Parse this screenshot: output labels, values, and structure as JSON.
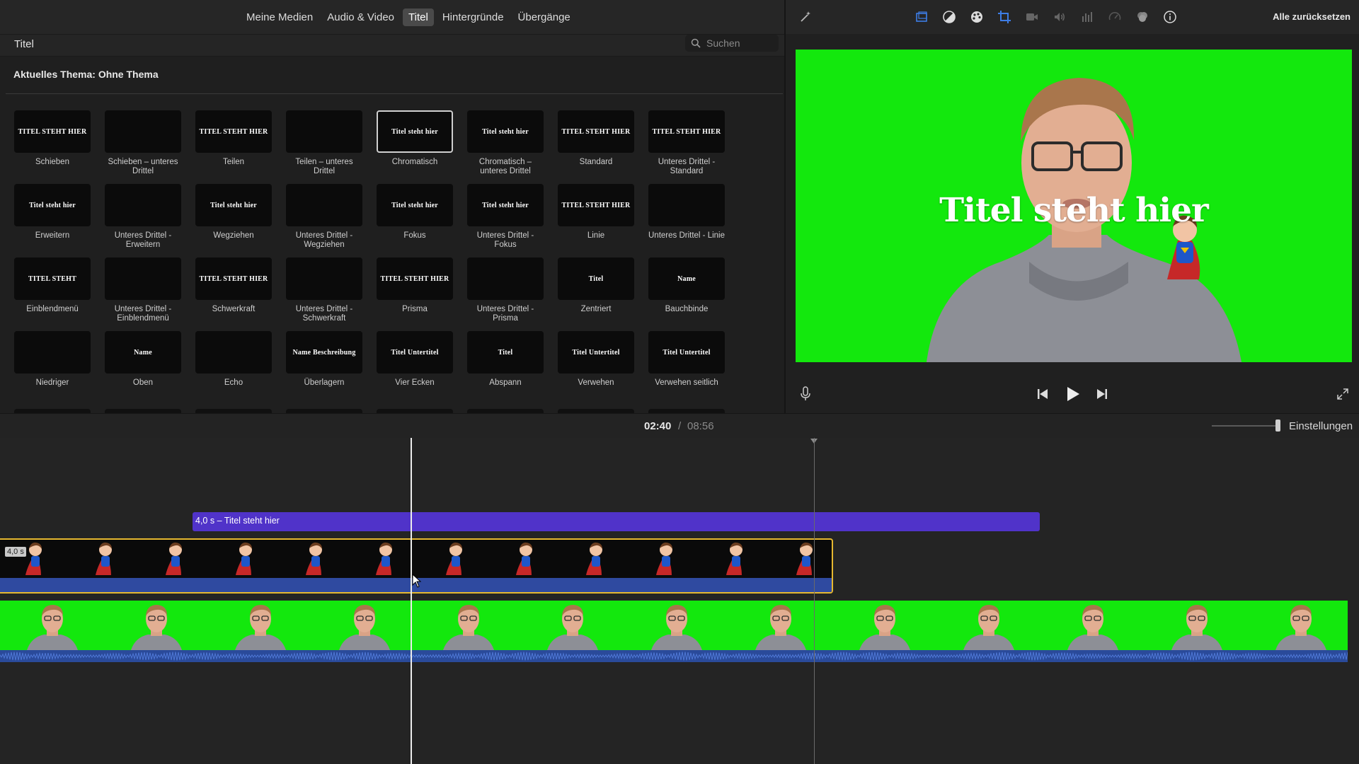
{
  "tabs": [
    {
      "label": "Meine Medien",
      "active": false
    },
    {
      "label": "Audio & Video",
      "active": false
    },
    {
      "label": "Titel",
      "active": true
    },
    {
      "label": "Hintergründe",
      "active": false
    },
    {
      "label": "Übergänge",
      "active": false
    }
  ],
  "browser": {
    "title": "Titel",
    "search_placeholder": "Suchen",
    "theme_label": "Aktuelles Thema: Ohne Thema"
  },
  "titles": [
    {
      "label": "Schieben",
      "thumb": "TITEL STEHT HIER"
    },
    {
      "label": "Schieben – unteres Drittel",
      "thumb": ""
    },
    {
      "label": "Teilen",
      "thumb": "TITEL STEHT HIER"
    },
    {
      "label": "Teilen – unteres Drittel",
      "thumb": ""
    },
    {
      "label": "Chromatisch",
      "thumb": "Titel steht hier",
      "selected": true
    },
    {
      "label": "Chromatisch – unteres Drittel",
      "thumb": "Titel steht hier"
    },
    {
      "label": "Standard",
      "thumb": "TITEL STEHT HIER"
    },
    {
      "label": "Unteres Drittel - Standard",
      "thumb": "TITEL STEHT HIER"
    },
    {
      "label": "Erweitern",
      "thumb": "Titel steht hier"
    },
    {
      "label": "Unteres Drittel - Erweitern",
      "thumb": ""
    },
    {
      "label": "Wegziehen",
      "thumb": "Titel steht hier"
    },
    {
      "label": "Unteres Drittel - Wegziehen",
      "thumb": ""
    },
    {
      "label": "Fokus",
      "thumb": "Titel steht hier"
    },
    {
      "label": "Unteres Drittel - Fokus",
      "thumb": "Titel steht hier"
    },
    {
      "label": "Linie",
      "thumb": "TITEL STEHT HIER"
    },
    {
      "label": "Unteres Drittel - Linie",
      "thumb": ""
    },
    {
      "label": "Einblendmenü",
      "thumb": "TITEL STEHT"
    },
    {
      "label": "Unteres Drittel - Einblendmenü",
      "thumb": ""
    },
    {
      "label": "Schwerkraft",
      "thumb": "TITEL STEHT HIER"
    },
    {
      "label": "Unteres Drittel - Schwerkraft",
      "thumb": ""
    },
    {
      "label": "Prisma",
      "thumb": "TITEL STEHT HIER"
    },
    {
      "label": "Unteres Drittel - Prisma",
      "thumb": ""
    },
    {
      "label": "Zentriert",
      "thumb": "Titel"
    },
    {
      "label": "Bauchbinde",
      "thumb": "Name"
    },
    {
      "label": "Niedriger",
      "thumb": ""
    },
    {
      "label": "Oben",
      "thumb": "Name"
    },
    {
      "label": "Echo",
      "thumb": ""
    },
    {
      "label": "Überlagern",
      "thumb": "Name Beschreibung"
    },
    {
      "label": "Vier Ecken",
      "thumb": "Titel Untertitel"
    },
    {
      "label": "Abspann",
      "thumb": "Titel"
    },
    {
      "label": "Verwehen",
      "thumb": "Titel Untertitel"
    },
    {
      "label": "Verwehen seitlich",
      "thumb": "Titel Untertitel"
    }
  ],
  "viewer": {
    "reset_label": "Alle zurücksetzen",
    "preview_title": "Titel steht hier",
    "preview_bg": "#13e80d",
    "tool_icons": [
      "magic-wand-icon",
      "crop-size-icon",
      "color-balance-icon",
      "color-correction-icon",
      "crop-icon",
      "stabilization-icon",
      "volume-icon",
      "noise-reduction-icon",
      "speed-icon",
      "clip-filter-icon",
      "info-icon"
    ]
  },
  "timeline": {
    "current_time": "02:40",
    "separator": "/",
    "total_time": "08:56",
    "settings_label": "Einstellungen",
    "title_clip_label": "4,0 s – Titel steht hier",
    "overlay_clip_duration": "4,0 s",
    "title_clip_color": "#5033c9",
    "overlay_border_color": "#e6b830"
  }
}
